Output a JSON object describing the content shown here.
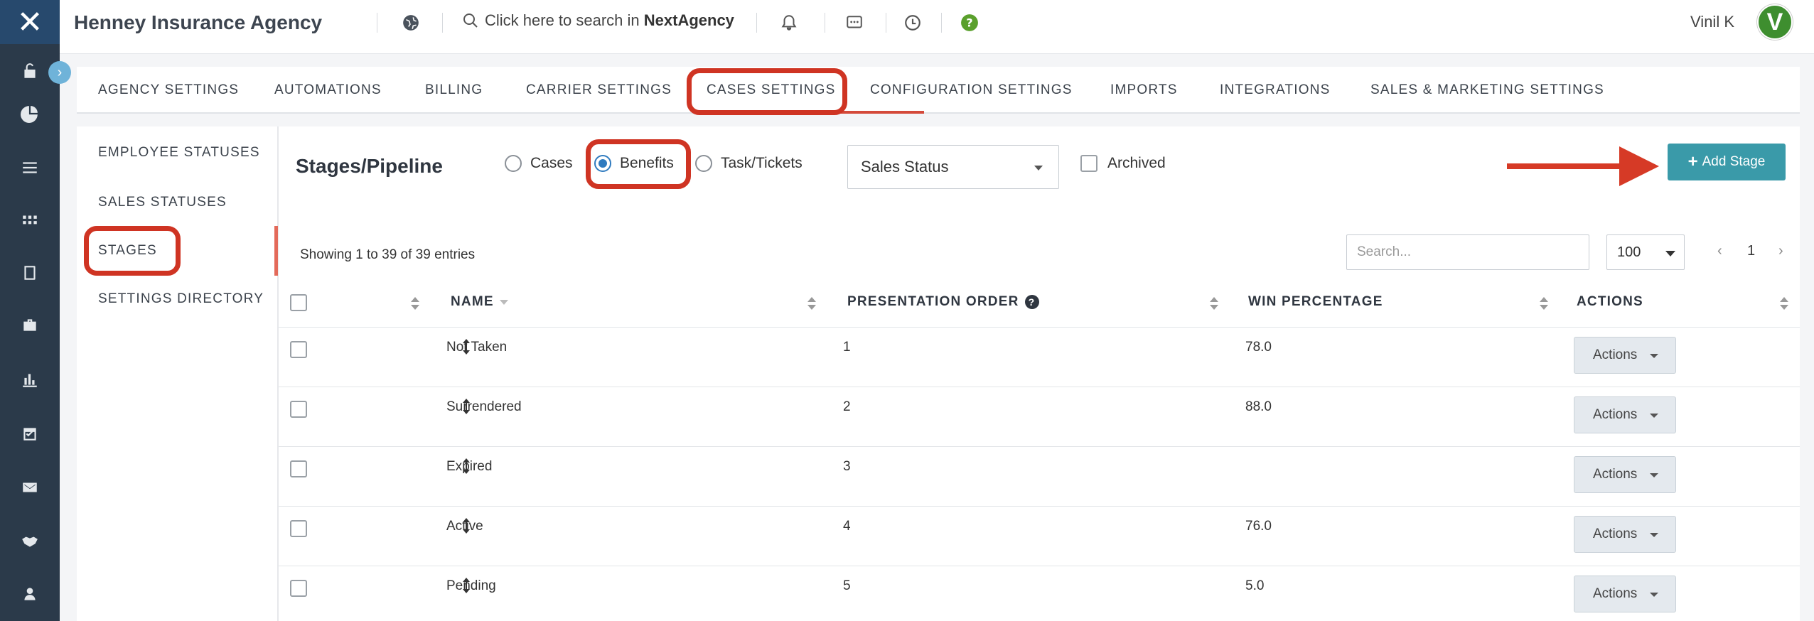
{
  "app": {
    "agency_name": "Henney Insurance Agency",
    "logo": "NX-logo"
  },
  "search": {
    "prefix": "Click here to search in ",
    "brand": "NextAgency"
  },
  "user": {
    "name": "Vinil K",
    "initial": "V",
    "avatar_color": "#3e8e2f"
  },
  "tabs": [
    {
      "label": "AGENCY SETTINGS"
    },
    {
      "label": "AUTOMATIONS"
    },
    {
      "label": "BILLING"
    },
    {
      "label": "CARRIER SETTINGS"
    },
    {
      "label": "CASES SETTINGS",
      "active": true
    },
    {
      "label": "CONFIGURATION SETTINGS"
    },
    {
      "label": "IMPORTS"
    },
    {
      "label": "INTEGRATIONS"
    },
    {
      "label": "SALES & MARKETING SETTINGS"
    }
  ],
  "left_nav": [
    {
      "label": "EMPLOYEE STATUSES"
    },
    {
      "label": "SALES STATUSES"
    },
    {
      "label": "STAGES",
      "active": true
    },
    {
      "label": "SETTINGS DIRECTORY"
    }
  ],
  "section": {
    "title": "Stages/Pipeline",
    "radios": [
      {
        "label": "Cases",
        "checked": false
      },
      {
        "label": "Benefits",
        "checked": true
      },
      {
        "label": "Task/Tickets",
        "checked": false
      }
    ],
    "status_select": "Sales Status",
    "archived_label": "Archived",
    "add_button": "Add Stage"
  },
  "table": {
    "showing": "Showing 1 to 39 of 39 entries",
    "search_placeholder": "Search...",
    "page_size": "100",
    "current_page": "1",
    "headers": {
      "name": "NAME",
      "order": "PRESENTATION ORDER",
      "win": "WIN PERCENTAGE",
      "actions": "ACTIONS"
    },
    "rows": [
      {
        "name": "Not Taken",
        "order": "1",
        "win": "78.0",
        "action": "Actions"
      },
      {
        "name": "Surrendered",
        "order": "2",
        "win": "88.0",
        "action": "Actions"
      },
      {
        "name": "Expired",
        "order": "3",
        "win": "",
        "action": "Actions"
      },
      {
        "name": "Active",
        "order": "4",
        "win": "76.0",
        "action": "Actions"
      },
      {
        "name": "Pending",
        "order": "5",
        "win": "5.0",
        "action": "Actions"
      }
    ]
  },
  "colors": {
    "sidebar": "#2b3a4a",
    "accent": "#3a9aa9",
    "highlight": "#cf3423"
  }
}
